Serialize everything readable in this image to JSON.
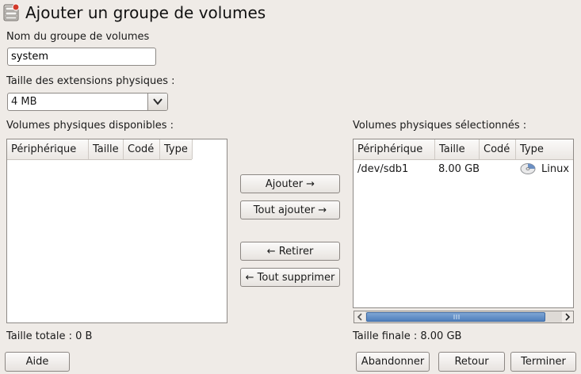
{
  "title": "Ajouter un groupe de volumes",
  "vg_name": {
    "label": "Nom du groupe de volumes",
    "value": "system"
  },
  "pe_size": {
    "label": "Taille des extensions physiques :",
    "value": "4 MB"
  },
  "available": {
    "label": "Volumes physiques disponibles :",
    "columns": [
      "Périphérique",
      "Taille",
      "Codé",
      "Type"
    ],
    "total": "Taille totale : 0 B"
  },
  "selected": {
    "label": "Volumes physiques sélectionnés :",
    "columns": [
      "Périphérique",
      "Taille",
      "Codé",
      "Type"
    ],
    "rows": [
      {
        "device": "/dev/sdb1",
        "size": "8.00 GB",
        "encrypted": "",
        "type": "Linux L",
        "icon": "disk-icon"
      }
    ],
    "total": "Taille finale : 8.00 GB"
  },
  "actions": {
    "add": "Ajouter →",
    "add_all": "Tout ajouter →",
    "remove": "← Retirer",
    "remove_all": "← Tout supprimer"
  },
  "footer": {
    "help": "Aide",
    "abort": "Abandonner",
    "back": "Retour",
    "finish": "Terminer"
  },
  "colors": {
    "scroll_thumb": "#4f7fbc",
    "background": "#efebe7"
  }
}
